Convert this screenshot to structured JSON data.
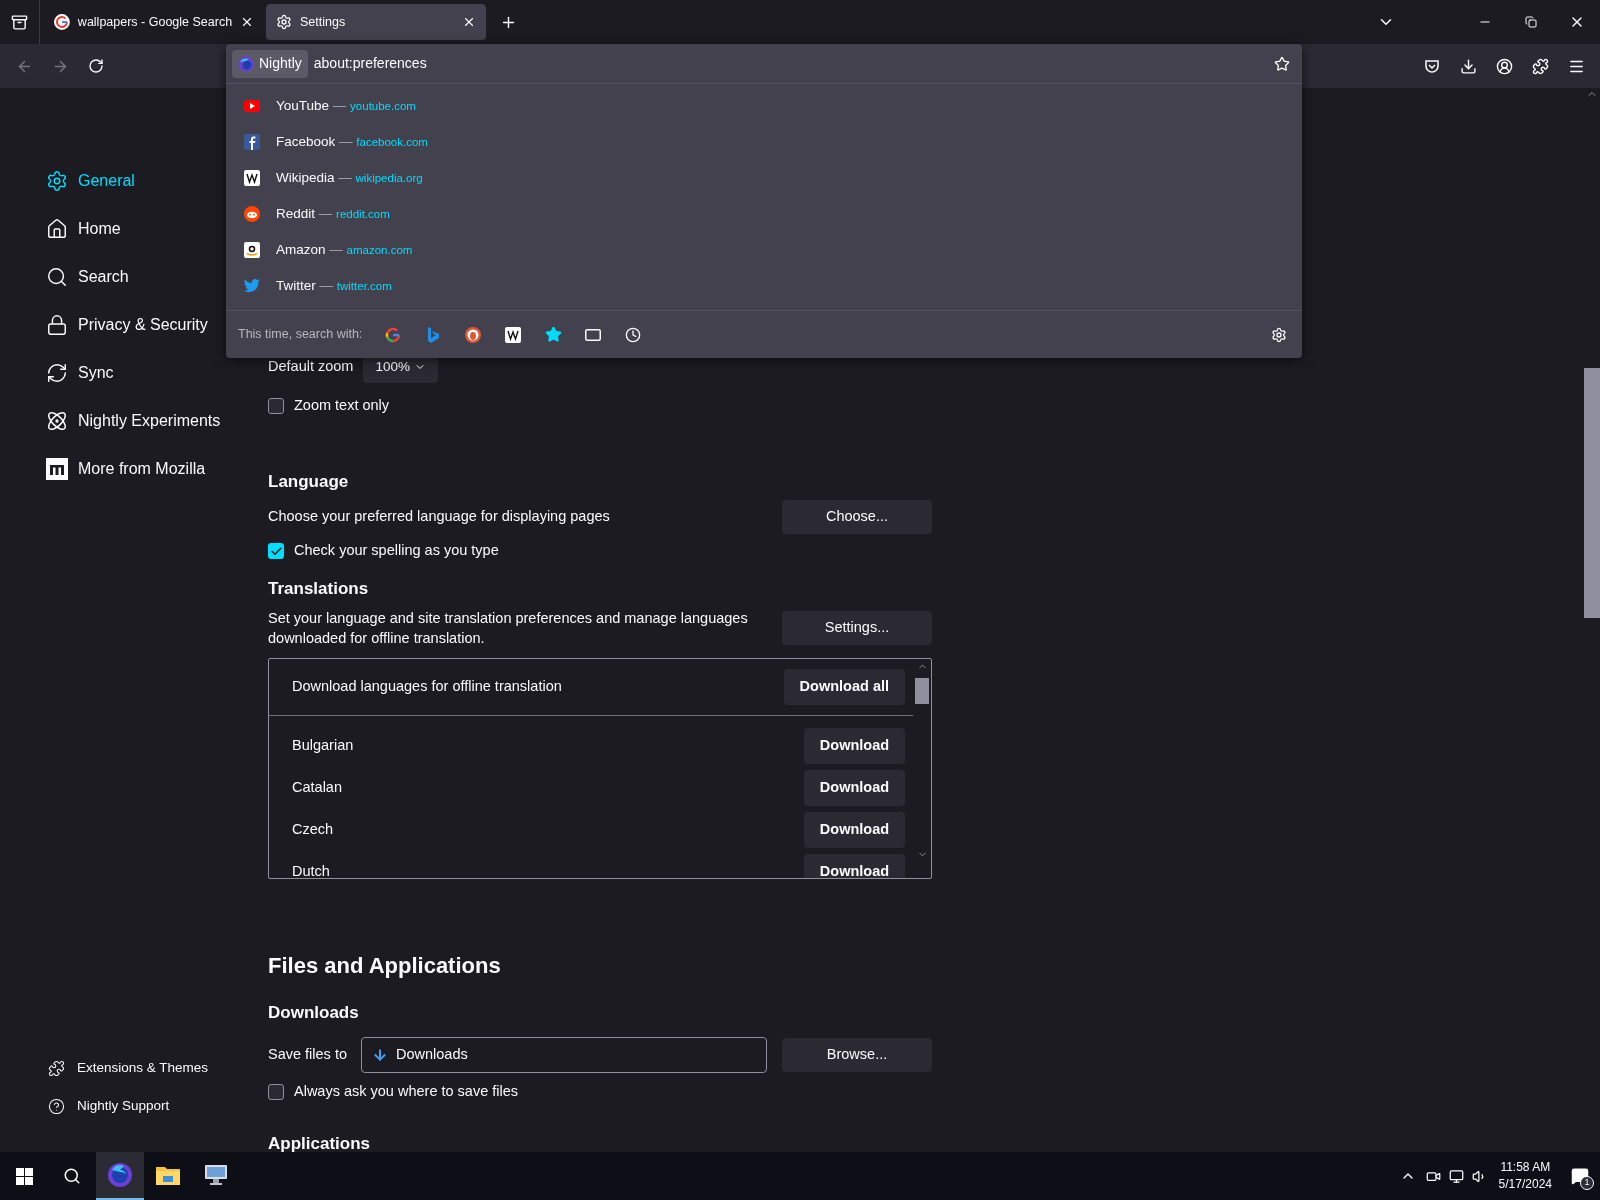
{
  "tabs": [
    {
      "title": "wallpapers - Google Search",
      "selected": false
    },
    {
      "title": "Settings",
      "selected": true
    }
  ],
  "url_bar": {
    "identity": "Nightly",
    "url": "about:preferences"
  },
  "suggestions": [
    {
      "title": "YouTube",
      "sep": "—",
      "url": "youtube.com"
    },
    {
      "title": "Facebook",
      "sep": "—",
      "url": "facebook.com"
    },
    {
      "title": "Wikipedia",
      "sep": "—",
      "url": "wikipedia.org"
    },
    {
      "title": "Reddit",
      "sep": "—",
      "url": "reddit.com"
    },
    {
      "title": "Amazon",
      "sep": "—",
      "url": "amazon.com"
    },
    {
      "title": "Twitter",
      "sep": "—",
      "url": "twitter.com"
    }
  ],
  "search_with": {
    "label": "This time, search with:"
  },
  "sidebar": {
    "items": [
      {
        "label": "General",
        "selected": true
      },
      {
        "label": "Home",
        "selected": false
      },
      {
        "label": "Search",
        "selected": false
      },
      {
        "label": "Privacy & Security",
        "selected": false
      },
      {
        "label": "Sync",
        "selected": false
      },
      {
        "label": "Nightly Experiments",
        "selected": false
      },
      {
        "label": "More from Mozilla",
        "selected": false
      }
    ],
    "footer": [
      {
        "label": "Extensions & Themes"
      },
      {
        "label": "Nightly Support"
      }
    ]
  },
  "zoom": {
    "label": "Default zoom",
    "value": "100%",
    "text_only": {
      "label": "Zoom text only",
      "checked": false
    }
  },
  "language": {
    "heading": "Language",
    "description": "Choose your preferred language for displaying pages",
    "button": "Choose...",
    "spell": {
      "label": "Check your spelling as you type",
      "checked": true
    }
  },
  "translations": {
    "heading": "Translations",
    "description": "Set your language and site translation preferences and manage languages downloaded for offline translation.",
    "button": "Settings...",
    "header": "Download languages for offline translation",
    "download_all": "Download all",
    "languages": [
      {
        "name": "Bulgarian",
        "button": "Download"
      },
      {
        "name": "Catalan",
        "button": "Download"
      },
      {
        "name": "Czech",
        "button": "Download"
      },
      {
        "name": "Dutch",
        "button": "Download"
      }
    ]
  },
  "files": {
    "heading": "Files and Applications",
    "downloads_heading": "Downloads",
    "save_label": "Save files to",
    "folder": "Downloads",
    "browse": "Browse...",
    "always_ask": {
      "label": "Always ask you where to save files",
      "checked": false
    },
    "next_heading": "Applications"
  },
  "taskbar": {
    "apps": [
      {
        "selected": true
      },
      {
        "selected": false
      },
      {
        "selected": false
      }
    ],
    "time": "11:58 AM",
    "date": "5/17/2024",
    "notifications": "1"
  }
}
